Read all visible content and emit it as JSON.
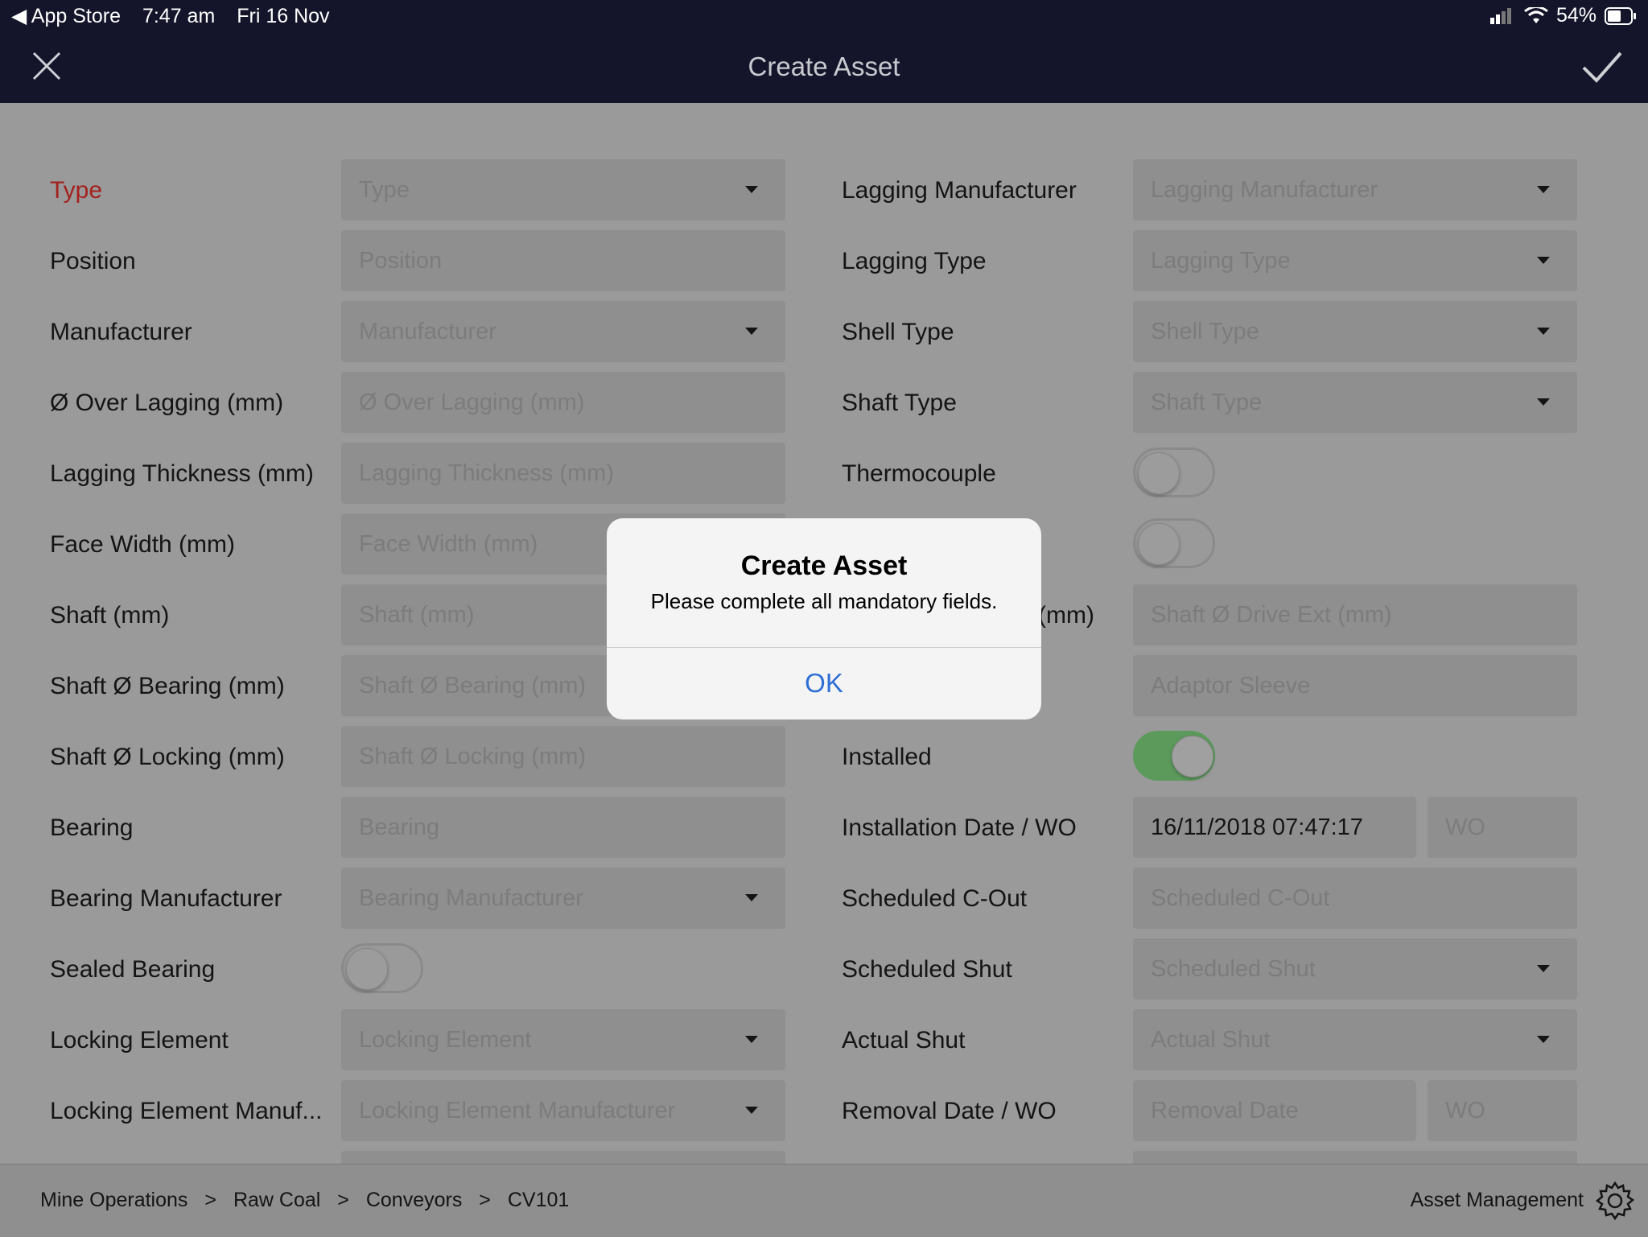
{
  "status_bar": {
    "back_app": "◀ App Store",
    "time": "7:47 am",
    "date": "Fri 16 Nov",
    "battery": "54%"
  },
  "nav": {
    "title": "Create Asset"
  },
  "form": {
    "left": [
      {
        "label": "Type",
        "placeholder": "Type",
        "kind": "dropdown",
        "required": true
      },
      {
        "label": "Position",
        "placeholder": "Position",
        "kind": "text"
      },
      {
        "label": "Manufacturer",
        "placeholder": "Manufacturer",
        "kind": "dropdown"
      },
      {
        "label": "Ø Over Lagging (mm)",
        "placeholder": "Ø Over Lagging (mm)",
        "kind": "text"
      },
      {
        "label": "Lagging Thickness (mm)",
        "placeholder": "Lagging Thickness (mm)",
        "kind": "text"
      },
      {
        "label": "Face Width (mm)",
        "placeholder": "Face Width (mm)",
        "kind": "text"
      },
      {
        "label": "Shaft (mm)",
        "placeholder": "Shaft (mm)",
        "kind": "text"
      },
      {
        "label": "Shaft Ø Bearing (mm)",
        "placeholder": "Shaft Ø Bearing (mm)",
        "kind": "text"
      },
      {
        "label": "Shaft Ø Locking (mm)",
        "placeholder": "Shaft Ø Locking (mm)",
        "kind": "text"
      },
      {
        "label": "Bearing",
        "placeholder": "Bearing",
        "kind": "text"
      },
      {
        "label": "Bearing Manufacturer",
        "placeholder": "Bearing Manufacturer",
        "kind": "dropdown"
      },
      {
        "label": "Sealed Bearing",
        "kind": "toggle",
        "on": false
      },
      {
        "label": "Locking Element",
        "placeholder": "Locking Element",
        "kind": "dropdown"
      },
      {
        "label": "Locking Element Manuf...",
        "placeholder": "Locking Element Manufacturer",
        "kind": "dropdown"
      }
    ],
    "right": [
      {
        "label": "Lagging Manufacturer",
        "placeholder": "Lagging Manufacturer",
        "kind": "dropdown"
      },
      {
        "label": "Lagging Type",
        "placeholder": "Lagging Type",
        "kind": "dropdown"
      },
      {
        "label": "Shell Type",
        "placeholder": "Shell Type",
        "kind": "dropdown"
      },
      {
        "label": "Shaft Type",
        "placeholder": "Shaft Type",
        "kind": "dropdown"
      },
      {
        "label": "Thermocouple",
        "kind": "toggle",
        "on": false
      },
      {
        "label": "",
        "kind": "toggle",
        "on": false
      },
      {
        "label": "(mm)",
        "placeholder": "Shaft Ø Drive Ext (mm)",
        "kind": "text"
      },
      {
        "label": "",
        "placeholder": "Adaptor Sleeve",
        "kind": "text"
      },
      {
        "label": "Installed",
        "kind": "toggle",
        "on": true
      },
      {
        "label": "Installation Date / WO",
        "value": "16/11/2018 07:47:17",
        "wo_placeholder": "WO",
        "kind": "date_wo"
      },
      {
        "label": "Scheduled C-Out",
        "placeholder": "Scheduled C-Out",
        "kind": "text"
      },
      {
        "label": "Scheduled Shut",
        "placeholder": "Scheduled Shut",
        "kind": "dropdown"
      },
      {
        "label": "Actual Shut",
        "placeholder": "Actual Shut",
        "kind": "dropdown"
      },
      {
        "label": "Removal Date / WO",
        "placeholder": "Removal Date",
        "wo_placeholder": "WO",
        "kind": "date_wo"
      }
    ]
  },
  "alert": {
    "title": "Create Asset",
    "message": "Please complete all mandatory fields.",
    "ok_label": "OK"
  },
  "footer": {
    "breadcrumb": [
      "Mine Operations",
      ">",
      "Raw Coal",
      ">",
      "Conveyors",
      ">",
      "CV101"
    ],
    "app_name": "Asset Management"
  },
  "colors": {
    "nav_bg": "#14152a",
    "required_label": "#a3211d",
    "toggle_on": "#5c9a5c",
    "link_blue": "#2f6fd6"
  },
  "icons": [
    "close-icon",
    "checkmark-icon",
    "wifi-icon",
    "signal-icon",
    "battery-icon",
    "gear-icon",
    "dropdown-caret-icon"
  ]
}
